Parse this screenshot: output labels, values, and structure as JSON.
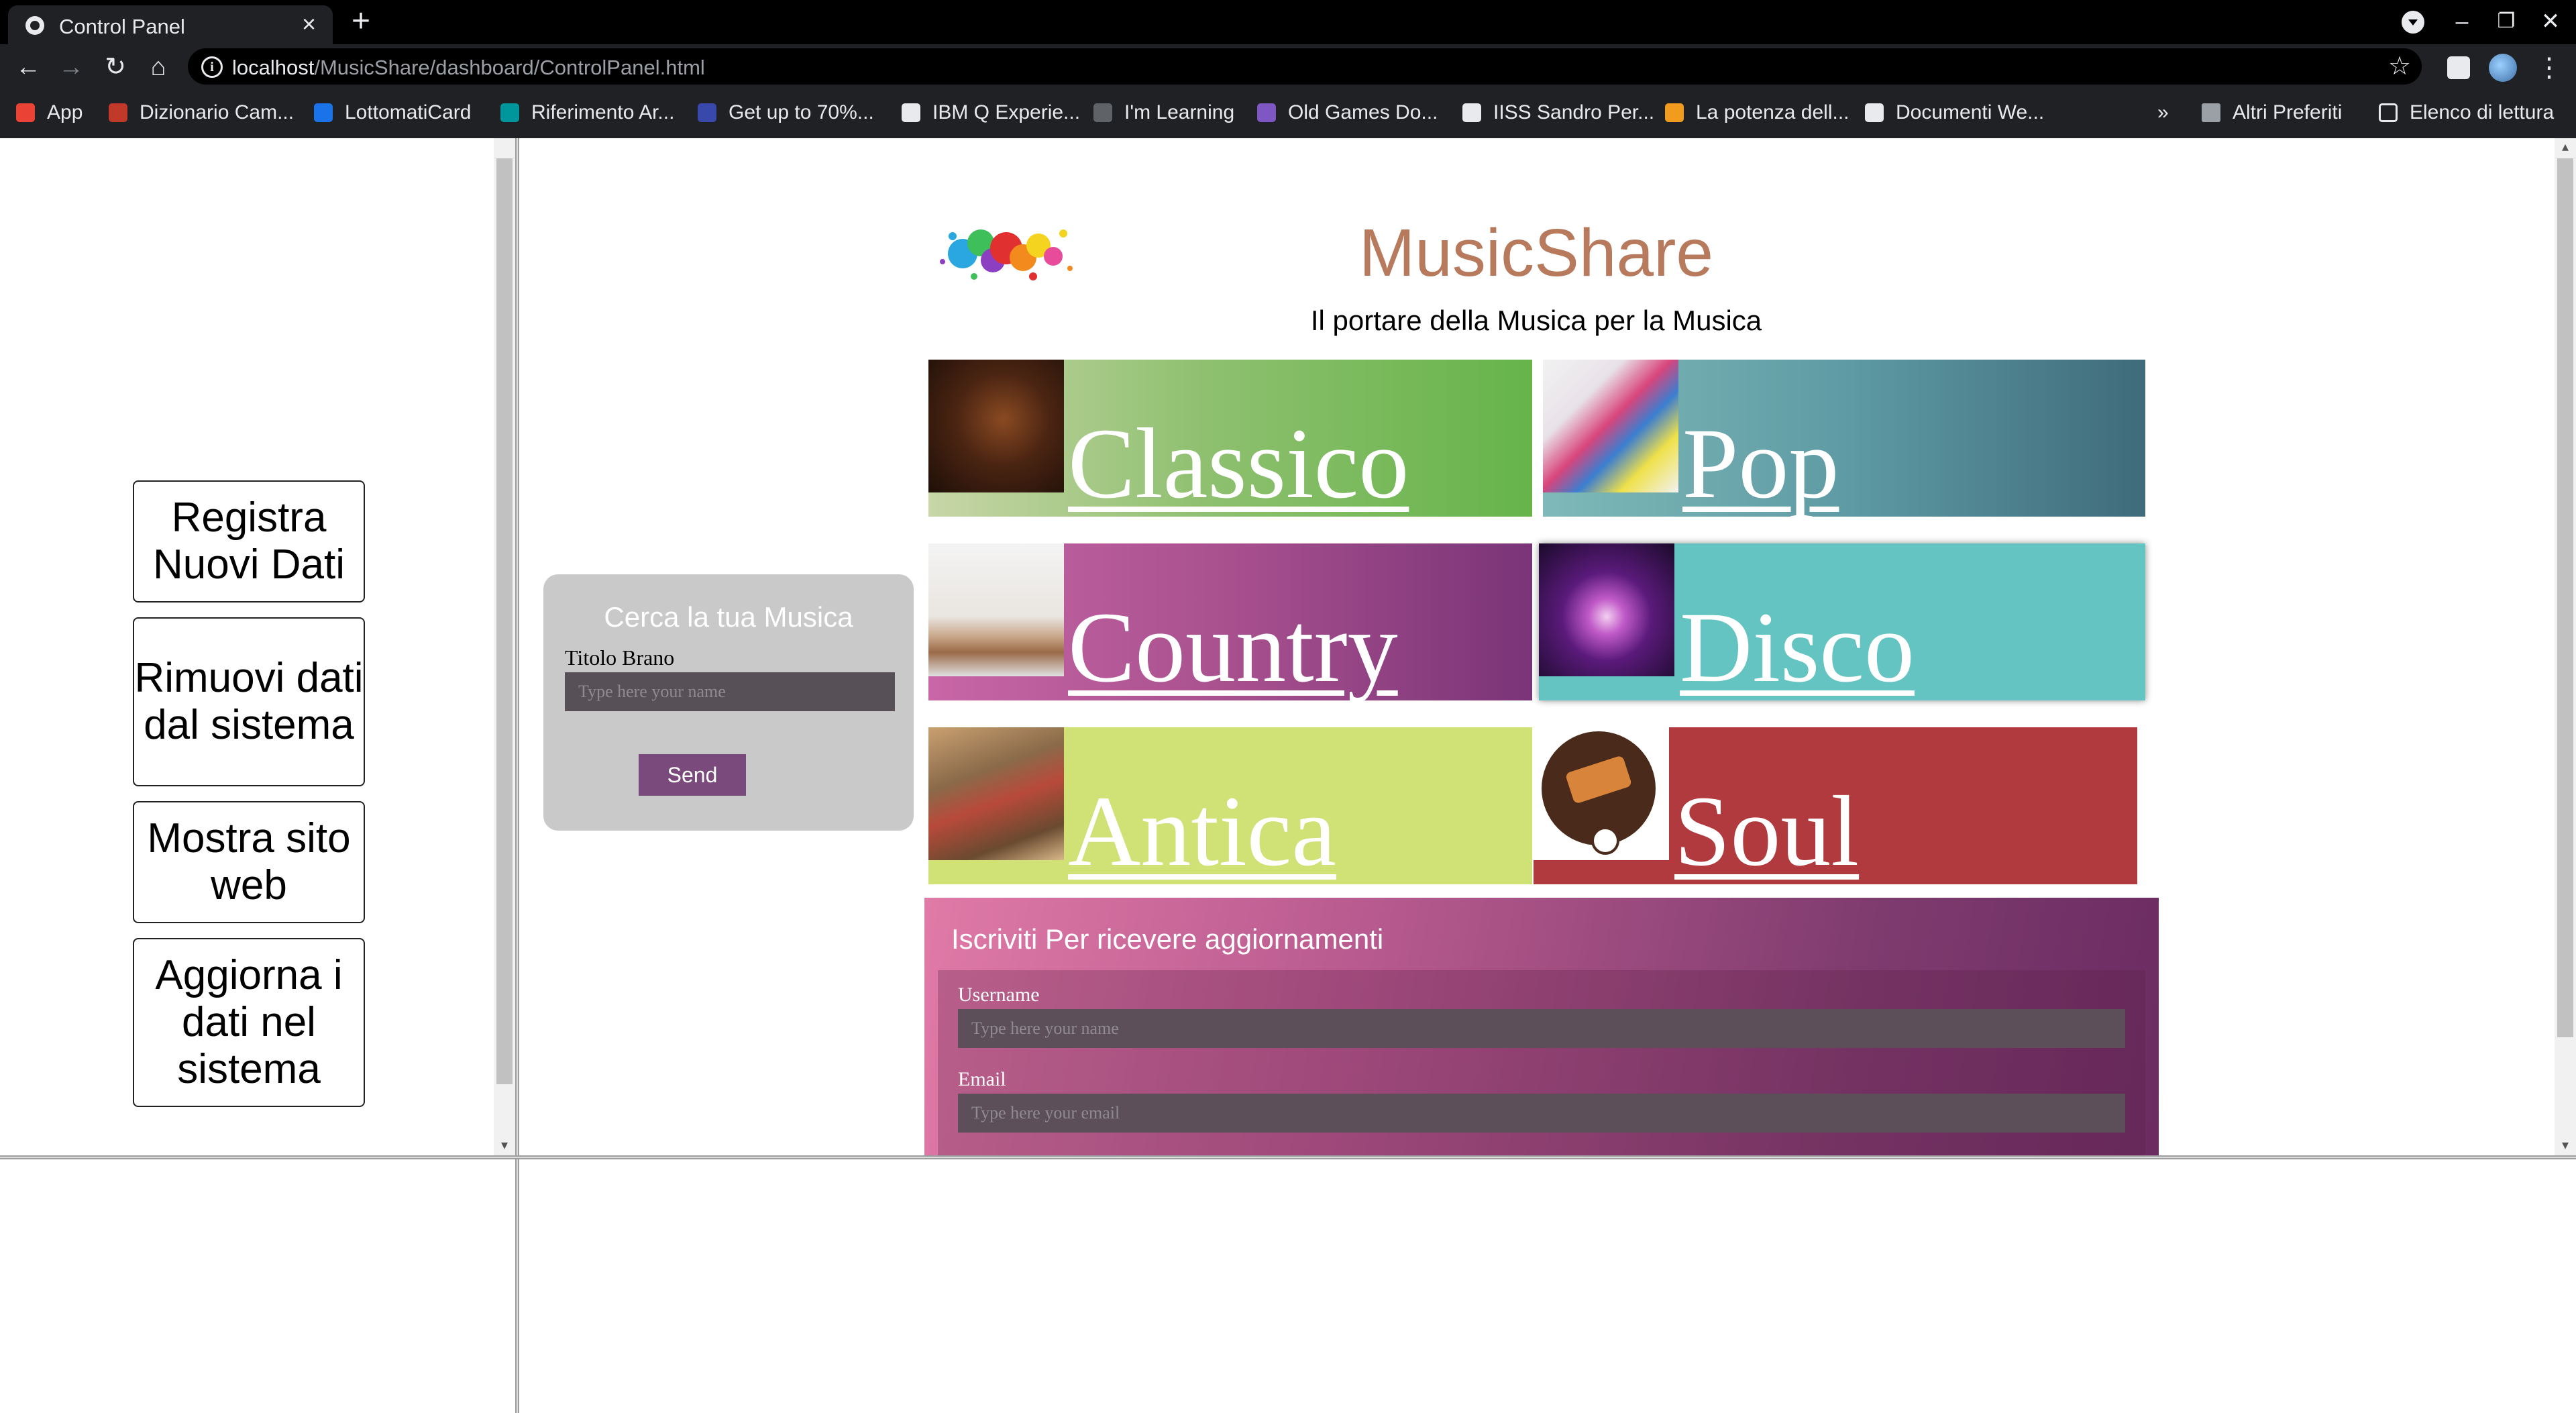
{
  "browser": {
    "tab_title": "Control Panel",
    "url_host": "localhost",
    "url_path": "/MusicShare/dashboard/ControlPanel.html",
    "bookmarks": [
      {
        "label": "App",
        "icon": "apps-grid-icon",
        "color": "#ea4335"
      },
      {
        "label": "Dizionario Cam...",
        "icon": "dictionary-icon",
        "color": "#c0392b"
      },
      {
        "label": "LottomatiCard",
        "icon": "lottomaticard-icon",
        "color": "#1a73e8"
      },
      {
        "label": "Riferimento Ar...",
        "icon": "arduino-icon",
        "color": "#00979c"
      },
      {
        "label": "Get up to 70%...",
        "icon": "coupon-icon",
        "color": "#3949ab"
      },
      {
        "label": "IBM Q Experie...",
        "icon": "location-pin-icon",
        "color": "#e8eaed"
      },
      {
        "label": "I'm Learning",
        "icon": "learning-icon",
        "color": "#5f6368"
      },
      {
        "label": "Old Games Do...",
        "icon": "old-games-icon",
        "color": "#7e57c2"
      },
      {
        "label": "IISS Sandro Per...",
        "icon": "school-icon",
        "color": "#e8eaed"
      },
      {
        "label": "La potenza dell...",
        "icon": "amazon-icon",
        "color": "#f29c1f"
      },
      {
        "label": "Documenti We...",
        "icon": "documents-icon",
        "color": "#e8eaed"
      }
    ],
    "more_bookmarks": "»",
    "other_favorites": "Altri Preferiti",
    "reading_list": "Elenco di lettura"
  },
  "sidebar": {
    "buttons": [
      "Registra Nuovi Dati",
      "Rimuovi dati dal sistema",
      "Mostra sito web",
      "Aggiorna i dati nel sistema"
    ]
  },
  "search": {
    "title": "Cerca la tua Musica",
    "label": "Titolo Brano",
    "placeholder": "Type here your name",
    "button": "Send"
  },
  "header": {
    "title": "MusicShare",
    "subtitle": "Il portare della Musica per la Musica"
  },
  "genres": [
    {
      "name": "Classico",
      "bg": "linear-gradient(90deg,#c8d6a8 0%,#8fc070 45%,#66b44a 100%)",
      "thumb": "violin-photo"
    },
    {
      "name": "Pop",
      "bg": "linear-gradient(90deg,#7fb9b8 0%,#5e9ba4 50%,#3f6b7a 100%)",
      "thumb": "music-graffiti-photo"
    },
    {
      "name": "Country",
      "bg": "linear-gradient(90deg,#c866a6 0%,#a8508e 50%,#7a3478 100%)",
      "thumb": "guitar-boots-photo"
    },
    {
      "name": "Disco",
      "bg": "#63c4c1",
      "thumb": "disco-ball-photo"
    },
    {
      "name": "Antica",
      "bg": "#d0e276",
      "thumb": "medieval-painting-photo"
    },
    {
      "name": "Soul",
      "bg": "#b03a3e",
      "thumb": "soul-music-logo"
    }
  ],
  "subscribe": {
    "title": "Iscriviti Per ricevere aggiornamenti",
    "username_label": "Username",
    "username_placeholder": "Type here your name",
    "email_label": "Email",
    "email_placeholder": "Type here your email"
  }
}
